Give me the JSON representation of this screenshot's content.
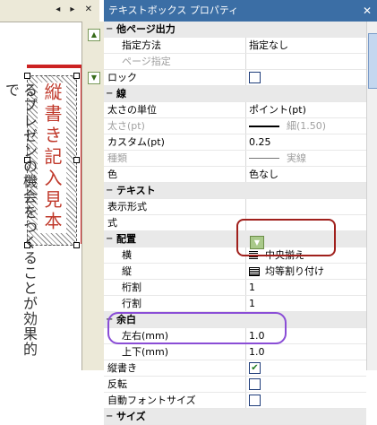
{
  "doc": {
    "tab_buttons": "◂ ▸ ✕",
    "box_text": "縦書き記入見本",
    "body_text": "るプレゼンの機会をつくることが効果的で"
  },
  "panel": {
    "title": "テキストボックス プロパティ",
    "close": "✕",
    "rows": [
      {
        "type": "section",
        "label": "他ページ出力"
      },
      {
        "label": "指定方法",
        "value": "指定なし",
        "indent": 1
      },
      {
        "label": "ページ指定",
        "value": "",
        "indent": 1,
        "disabled": true
      },
      {
        "label": "ロック",
        "check": "unchecked"
      },
      {
        "type": "section",
        "label": "線"
      },
      {
        "label": "太さの単位",
        "value": "ポイント(pt)"
      },
      {
        "label": "太さ(pt)",
        "value": "細(1.50)",
        "icon": "line",
        "disabled": true
      },
      {
        "label": "カスタム(pt)",
        "value": "0.25"
      },
      {
        "label": "種類",
        "value": "実線",
        "icon": "thinline",
        "disabled": true
      },
      {
        "label": "色",
        "value": "色なし"
      },
      {
        "type": "section",
        "label": "テキスト"
      },
      {
        "label": "表示形式",
        "value": ""
      },
      {
        "label": "式",
        "value": ""
      },
      {
        "type": "section",
        "label": "配置"
      },
      {
        "label": "横",
        "value": "中央揃え",
        "icon": "align",
        "indent": 1
      },
      {
        "label": "縦",
        "value": "均等割り付け",
        "icon": "alignbox",
        "indent": 1
      },
      {
        "label": "桁割",
        "value": "1",
        "indent": 1
      },
      {
        "label": "行割",
        "value": "1",
        "indent": 1
      },
      {
        "type": "section",
        "label": "余白"
      },
      {
        "label": "左右(mm)",
        "value": "1.0",
        "indent": 1
      },
      {
        "label": "上下(mm)",
        "value": "1.0",
        "indent": 1
      },
      {
        "label": "縦書き",
        "check": "checked"
      },
      {
        "label": "反転",
        "check": "unchecked"
      },
      {
        "label": "自動フォントサイズ",
        "check": "unchecked"
      },
      {
        "type": "section",
        "label": "サイズ"
      }
    ],
    "toggle_minus": "−",
    "check_mark": "✔",
    "dropdown_glyph": "▼"
  },
  "colors": {
    "highlight_red": "#a0201c",
    "highlight_purple": "#8a4dd6",
    "title_bar": "#3b6ea5"
  }
}
